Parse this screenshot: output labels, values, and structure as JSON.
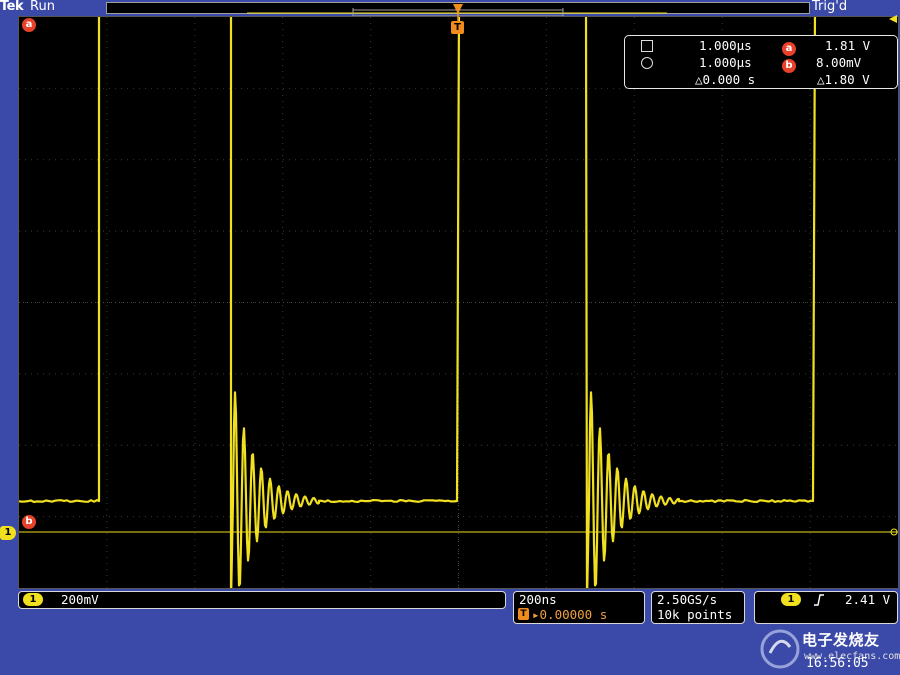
{
  "header": {
    "brand": "Tek",
    "run_state": "Run",
    "trigger_state": "Trig'd"
  },
  "markers": {
    "cursor_a": "a",
    "cursor_b": "b",
    "trigger_marker": "T",
    "channel_1": "1"
  },
  "cursor_readout": {
    "time_a": "1.000μs",
    "time_b": "1.000μs",
    "delta_time": "△0.000 s",
    "volt_a": "1.81 V",
    "volt_b": "8.00mV",
    "delta_volt": "△1.80 V"
  },
  "status_bar": {
    "channel_label": "1",
    "vertical_scale": "200mV",
    "horizontal_scale": "200ns",
    "trigger_position": "▸0.00000 s",
    "trigger_position_icon": "T",
    "sample_rate": "2.50GS/s",
    "record_length": "10k points",
    "trigger_source": "1",
    "trigger_slope_icon": "rising-edge-icon",
    "trigger_level": "2.41 V"
  },
  "watermark": {
    "text": "电子发烧友",
    "url": "www.elecfans.com"
  },
  "clock": "16:56:05",
  "colors": {
    "trace": "#f0e020",
    "cursor": "#f0e020",
    "marker_red": "#e8412a",
    "trigger_orange": "#f08c1e",
    "background": "#3b4aa8",
    "screen": "#000000"
  }
}
